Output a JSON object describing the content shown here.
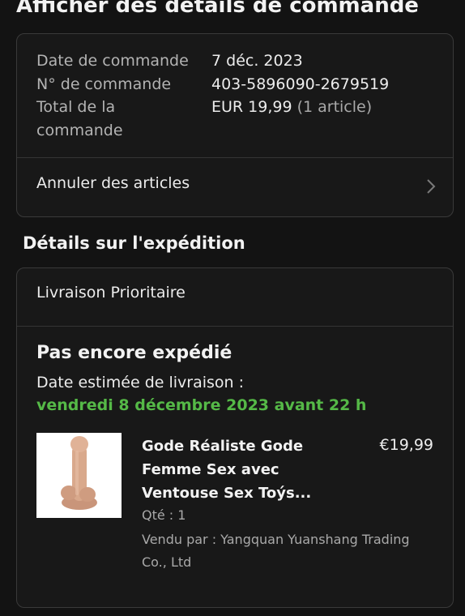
{
  "header": {
    "title": "Afficher des détails de commande"
  },
  "order": {
    "date_label": "Date de commande",
    "date_value": "7 déc. 2023",
    "number_label": "N° de commande",
    "number_value": "403-5896090-2679519",
    "total_label_line1": "Total de la",
    "total_label_line2": "commande",
    "total_value": "EUR 19,99",
    "total_items": " (1 article)",
    "cancel_label": "Annuler des articles"
  },
  "shipping": {
    "section_title": "Détails sur l'expédition",
    "method": "Livraison Prioritaire",
    "status": "Pas encore expédié",
    "estimate_label": "Date estimée de livraison :",
    "estimate_date": "vendredi 8 décembre 2023 avant 22 h",
    "accent_color": "#55b947"
  },
  "product": {
    "name_line1": "Gode Réaliste Gode",
    "name_line2": "Femme Sex avec",
    "name_line3": "Ventouse Sex Toýs...",
    "price": "€19,99",
    "quantity": "Qté : 1",
    "seller_line1": "Vendu par : Yangquan Yuanshang Trading",
    "seller_line2": "Co., Ltd"
  },
  "icons": {
    "cancel_chevron": "chevron-right-icon"
  }
}
